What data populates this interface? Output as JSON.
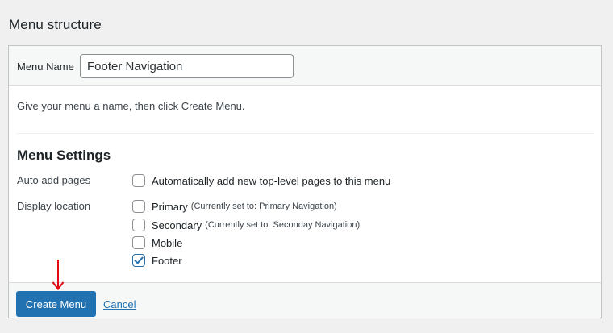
{
  "page": {
    "title": "Menu structure"
  },
  "menu_name": {
    "label": "Menu Name",
    "value": "Footer Navigation",
    "placeholder": ""
  },
  "hint": "Give your menu a name, then click Create Menu.",
  "settings": {
    "title": "Menu Settings",
    "auto_add": {
      "label": "Auto add pages",
      "option": {
        "label": "Automatically add new top-level pages to this menu",
        "checked": false
      }
    },
    "display_location": {
      "label": "Display location",
      "options": [
        {
          "label": "Primary",
          "note": "(Currently set to: Primary Navigation)",
          "checked": false
        },
        {
          "label": "Secondary",
          "note": "(Currently set to: Seconday Navigation)",
          "checked": false
        },
        {
          "label": "Mobile",
          "note": "",
          "checked": false
        },
        {
          "label": "Footer",
          "note": "",
          "checked": true
        }
      ]
    }
  },
  "actions": {
    "create_label": "Create Menu",
    "cancel_label": "Cancel"
  },
  "icons": {
    "checkmark": "check-icon",
    "annotation_arrow": "arrow-down-icon"
  },
  "colors": {
    "primary": "#2271b1",
    "annotation": "#e30613",
    "panel_bg": "#f6f7f7"
  }
}
